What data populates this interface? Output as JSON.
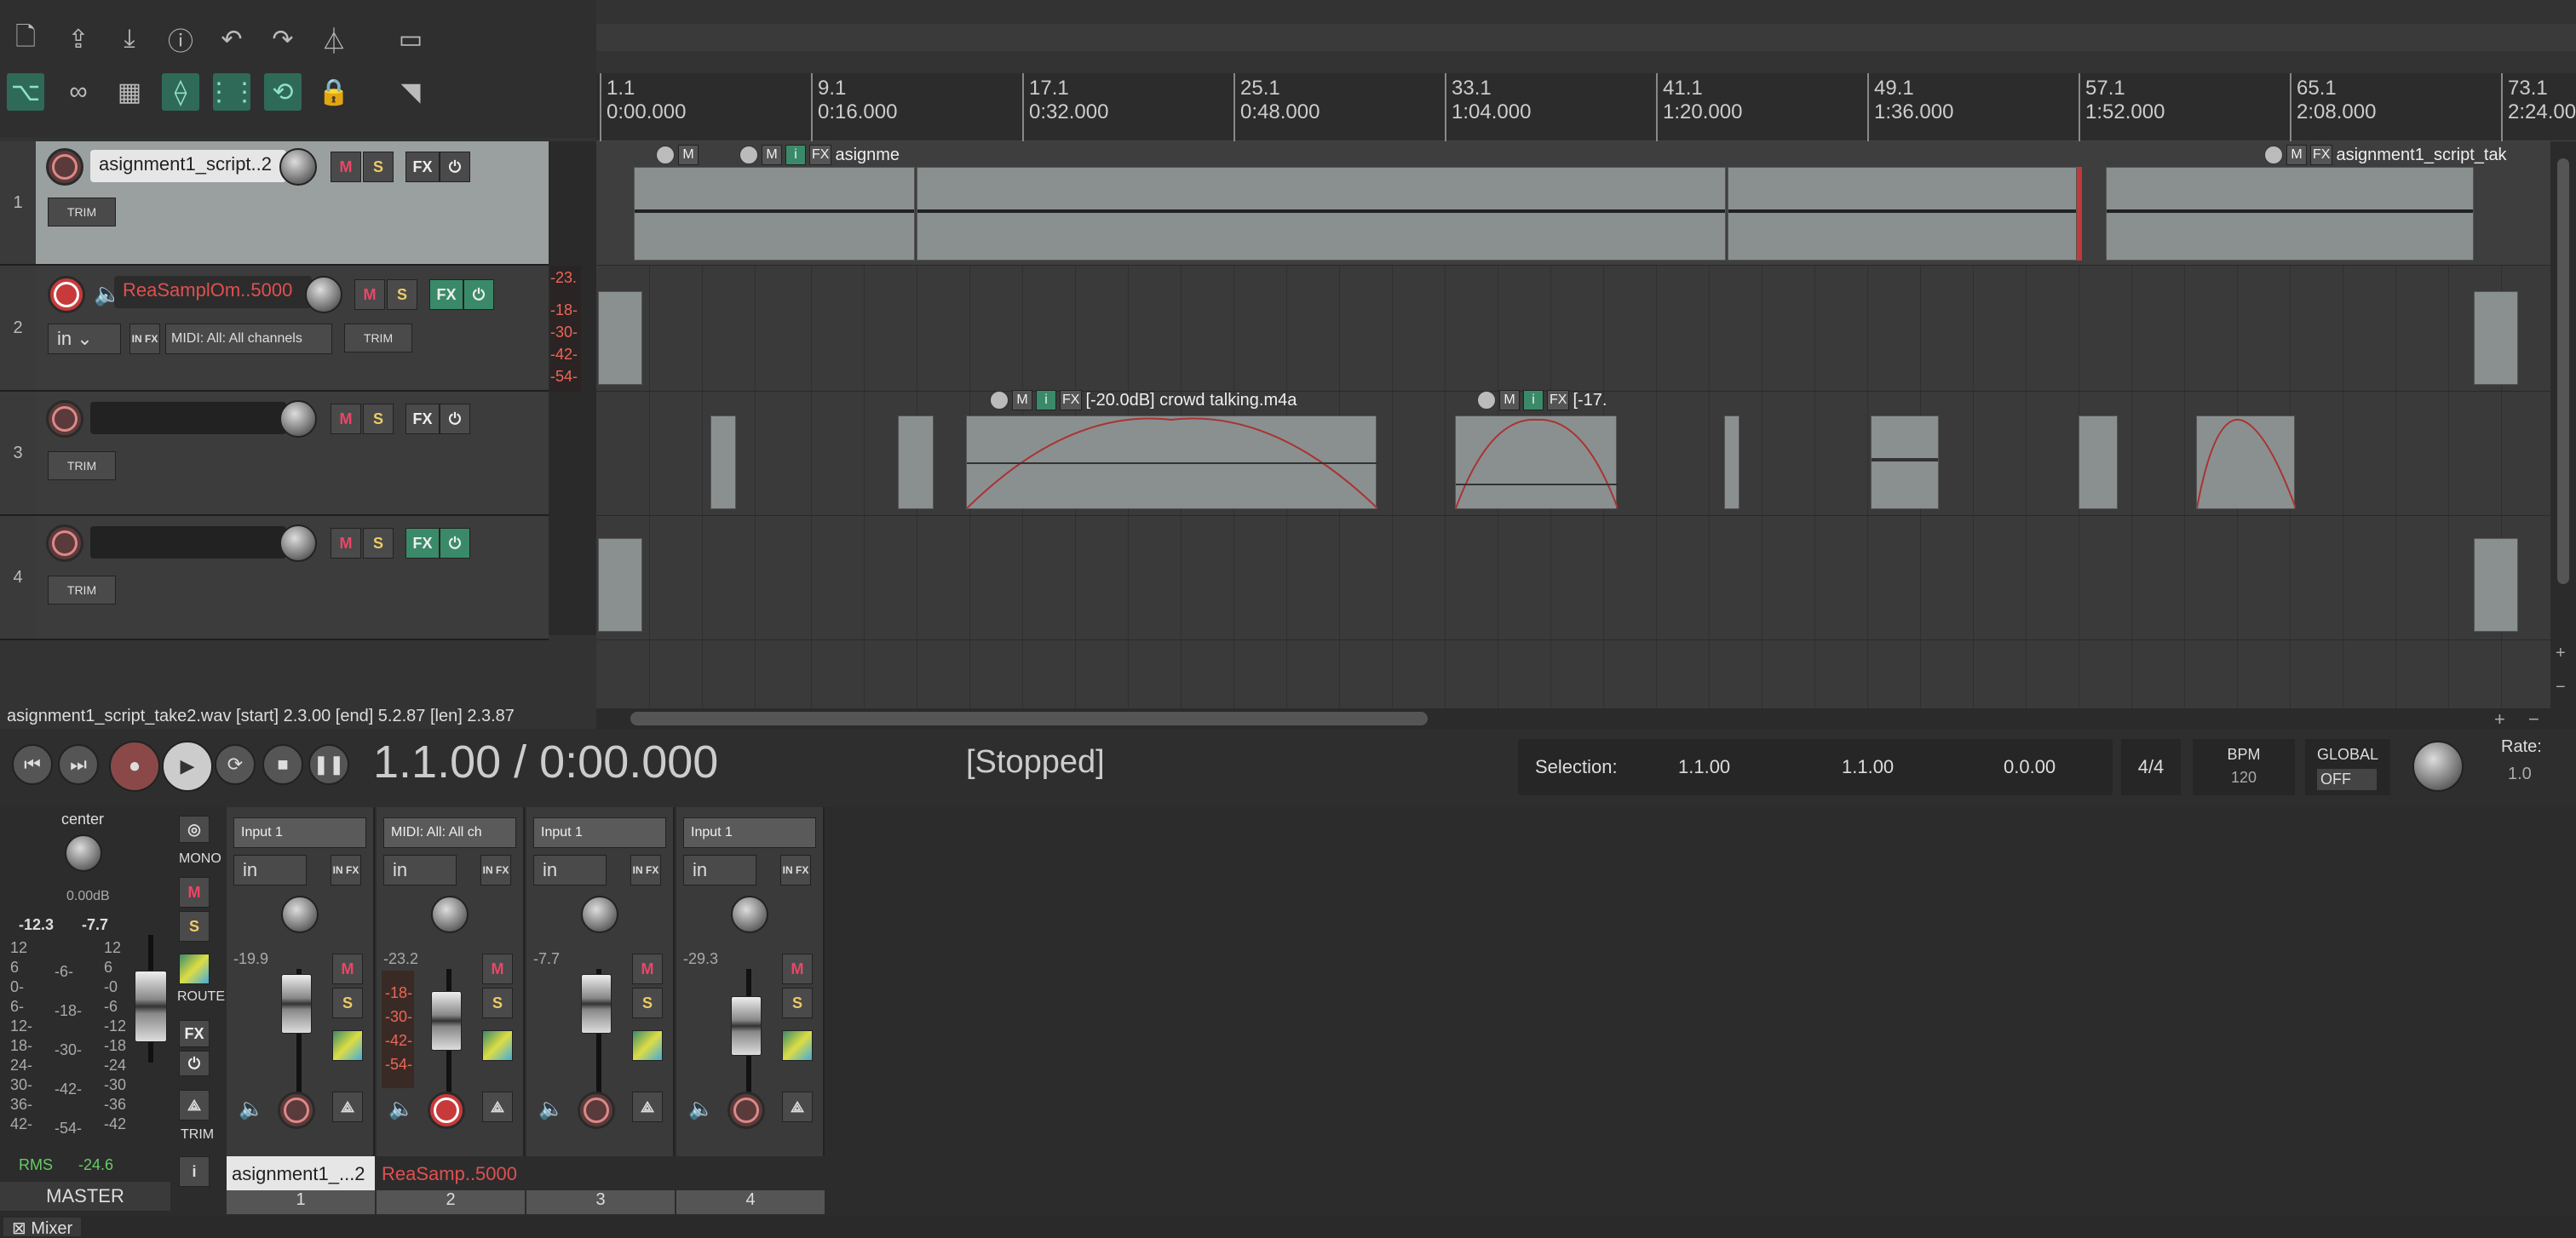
{
  "toolbar": {
    "icons_row1": [
      "new-project-icon",
      "open-project-icon",
      "save-project-icon",
      "project-info-icon",
      "undo-icon",
      "redo-icon",
      "metronome-icon",
      "blank-icon"
    ],
    "icons_row2": [
      "ripple-edit-icon",
      "item-grouping-icon",
      "grid-icon",
      "envelope-link-icon",
      "snap-icon",
      "loop-icon",
      "lock-icon",
      "cursor-tool-icon"
    ]
  },
  "ruler": {
    "marks": [
      {
        "bar": "1.1",
        "time": "0:00.000"
      },
      {
        "bar": "9.1",
        "time": "0:16.000"
      },
      {
        "bar": "17.1",
        "time": "0:32.000"
      },
      {
        "bar": "25.1",
        "time": "0:48.000"
      },
      {
        "bar": "33.1",
        "time": "1:04.000"
      },
      {
        "bar": "41.1",
        "time": "1:20.000"
      },
      {
        "bar": "49.1",
        "time": "1:36.000"
      },
      {
        "bar": "57.1",
        "time": "1:52.000"
      },
      {
        "bar": "65.1",
        "time": "2:08.000"
      },
      {
        "bar": "73.1",
        "time": "2:24.000"
      }
    ]
  },
  "tracks": [
    {
      "num": "1",
      "name": "asignment1_script..2",
      "fx": "FX",
      "trim": "TRIM"
    },
    {
      "num": "2",
      "name": "ReaSamplOm..5000",
      "fx": "FX",
      "trim": "TRIM",
      "input": "in",
      "midi": "MIDI: All: All channels",
      "meter": [
        "-23.",
        "-18-",
        "-30-",
        "-42-",
        "-54-"
      ]
    },
    {
      "num": "3",
      "name": "",
      "fx": "FX",
      "trim": "TRIM"
    },
    {
      "num": "4",
      "name": "",
      "fx": "FX",
      "trim": "TRIM"
    }
  ],
  "labels": {
    "m": "M",
    "s": "S",
    "i": "i",
    "fx": "FX",
    "infx": "IN FX"
  },
  "items": {
    "track1_a": "asignme",
    "track1_b": "asignment1_script_tak",
    "track3_a": "[-20.0dB] crowd talking.m4a",
    "track3_b": "[-17."
  },
  "status": {
    "text": "asignment1_script_take2.wav [start] 2.3.00 [end] 5.2.87 [len] 2.3.87"
  },
  "transport": {
    "time": "1.1.00 / 0:00.000",
    "state": "[Stopped]",
    "selection_label": "Selection:",
    "sel_start": "1.1.00",
    "sel_end": "1.1.00",
    "sel_len": "0.0.00",
    "timesig": "4/4",
    "bpm_label": "BPM",
    "bpm": "120",
    "global_label": "GLOBAL",
    "global_value": "OFF",
    "rate_label": "Rate:",
    "rate": "1.0"
  },
  "master": {
    "pan": "center",
    "vol": "0.00dB",
    "peak_l": "-12.3",
    "peak_r": "-7.7",
    "scale": [
      "12",
      "6",
      "0-",
      "6-",
      "12-",
      "18-",
      "24-",
      "30-",
      "36-",
      "42-"
    ],
    "scale_mid": [
      "-6-",
      "-18-",
      "-30-",
      "-42-",
      "-54-"
    ],
    "scale_r": [
      "12",
      "6",
      "-0",
      "-6",
      "-12",
      "-18",
      "-24",
      "-30",
      "-36",
      "-42"
    ],
    "rms_label": "RMS",
    "rms": "-24.6",
    "name": "MASTER",
    "mono": "MONO",
    "route": "ROUTE",
    "trim": "TRIM",
    "info": "i"
  },
  "strips": [
    {
      "input": "Input 1",
      "in": "in",
      "peak": "-19.9",
      "name": "asignment1_...2",
      "num": "1"
    },
    {
      "input": "MIDI: All: All ch",
      "in": "in",
      "peak": "-23.2",
      "name": "ReaSamp..5000",
      "num": "2",
      "meter": [
        "-18-",
        "-30-",
        "-42-",
        "-54-"
      ]
    },
    {
      "input": "Input 1",
      "in": "in",
      "peak": "-7.7",
      "name": "",
      "num": "3"
    },
    {
      "input": "Input 1",
      "in": "in",
      "peak": "-29.3",
      "name": "",
      "num": "4"
    }
  ],
  "mixer_tab": {
    "label": "Mixer"
  },
  "colors": {
    "accent_green": "#3a8a6a",
    "rec_red": "#c83a3a",
    "item_gray": "#8a9090",
    "track_name_red": "#e05050"
  }
}
